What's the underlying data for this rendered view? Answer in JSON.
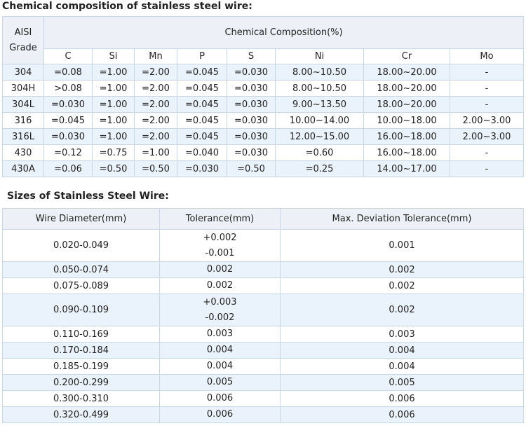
{
  "chem_heading": "Chemical composition of stainless steel wire:",
  "chem": {
    "grade_header": [
      "AISI",
      "Grade"
    ],
    "group_header": "Chemical Composition(%)",
    "elements": [
      "C",
      "Si",
      "Mn",
      "P",
      "S",
      "Ni",
      "Cr",
      "Mo"
    ],
    "rows": [
      [
        "304",
        "=0.08",
        "=1.00",
        "=2.00",
        "=0.045",
        "=0.030",
        "8.00~10.50",
        "18.00~20.00",
        "-"
      ],
      [
        "304H",
        ">0.08",
        "=1.00",
        "=2.00",
        "=0.045",
        "=0.030",
        "8.00~10.50",
        "18.00~20.00",
        "-"
      ],
      [
        "304L",
        "=0.030",
        "=1.00",
        "=2.00",
        "=0.045",
        "=0.030",
        "9.00~13.50",
        "18.00~20.00",
        "-"
      ],
      [
        "316",
        "=0.045",
        "=1.00",
        "=2.00",
        "=0.045",
        "=0.030",
        "10.00~14.00",
        "10.00~18.00",
        "2.00~3.00"
      ],
      [
        "316L",
        "=0.030",
        "=1.00",
        "=2.00",
        "=0.045",
        "=0.030",
        "12.00~15.00",
        "16.00~18.00",
        "2.00~3.00"
      ],
      [
        "430",
        "=0.12",
        "=0.75",
        "=1.00",
        "=0.040",
        "=0.030",
        "=0.60",
        "16.00~18.00",
        "-"
      ],
      [
        "430A",
        "=0.06",
        "=0.50",
        "=0.50",
        "=0.030",
        "=0.50",
        "=0.25",
        "14.00~17.00",
        "-"
      ]
    ]
  },
  "sizes_heading": "Sizes of Stainless Steel Wire:",
  "sizes": {
    "headers": [
      "Wire Diameter(mm)",
      "Tolerance(mm)",
      "Max. Deviation Tolerance(mm)"
    ],
    "rows": [
      {
        "diameter": "0.020-0.049",
        "tolerance": [
          "+0.002",
          "-0.001"
        ],
        "max_dev": "0.001"
      },
      {
        "diameter": "0.050-0.074",
        "tolerance": [
          "0.002"
        ],
        "max_dev": "0.002"
      },
      {
        "diameter": "0.075-0.089",
        "tolerance": [
          "0.002"
        ],
        "max_dev": "0.002"
      },
      {
        "diameter": "0.090-0.109",
        "tolerance": [
          "+0.003",
          "-0.002"
        ],
        "max_dev": "0.002"
      },
      {
        "diameter": "0.110-0.169",
        "tolerance": [
          "0.003"
        ],
        "max_dev": "0.003"
      },
      {
        "diameter": "0.170-0.184",
        "tolerance": [
          "0.004"
        ],
        "max_dev": "0.004"
      },
      {
        "diameter": "0.185-0.199",
        "tolerance": [
          "0.004"
        ],
        "max_dev": "0.004"
      },
      {
        "diameter": "0.200-0.299",
        "tolerance": [
          "0.005"
        ],
        "max_dev": "0.005"
      },
      {
        "diameter": "0.300-0.310",
        "tolerance": [
          "0.006"
        ],
        "max_dev": "0.006"
      },
      {
        "diameter": "0.320-0.499",
        "tolerance": [
          "0.006"
        ],
        "max_dev": "0.006"
      }
    ]
  },
  "colors": {
    "border": "#c9d6e6",
    "alt_row": "#eaf3fb",
    "header_bg": "#edf1f7"
  }
}
